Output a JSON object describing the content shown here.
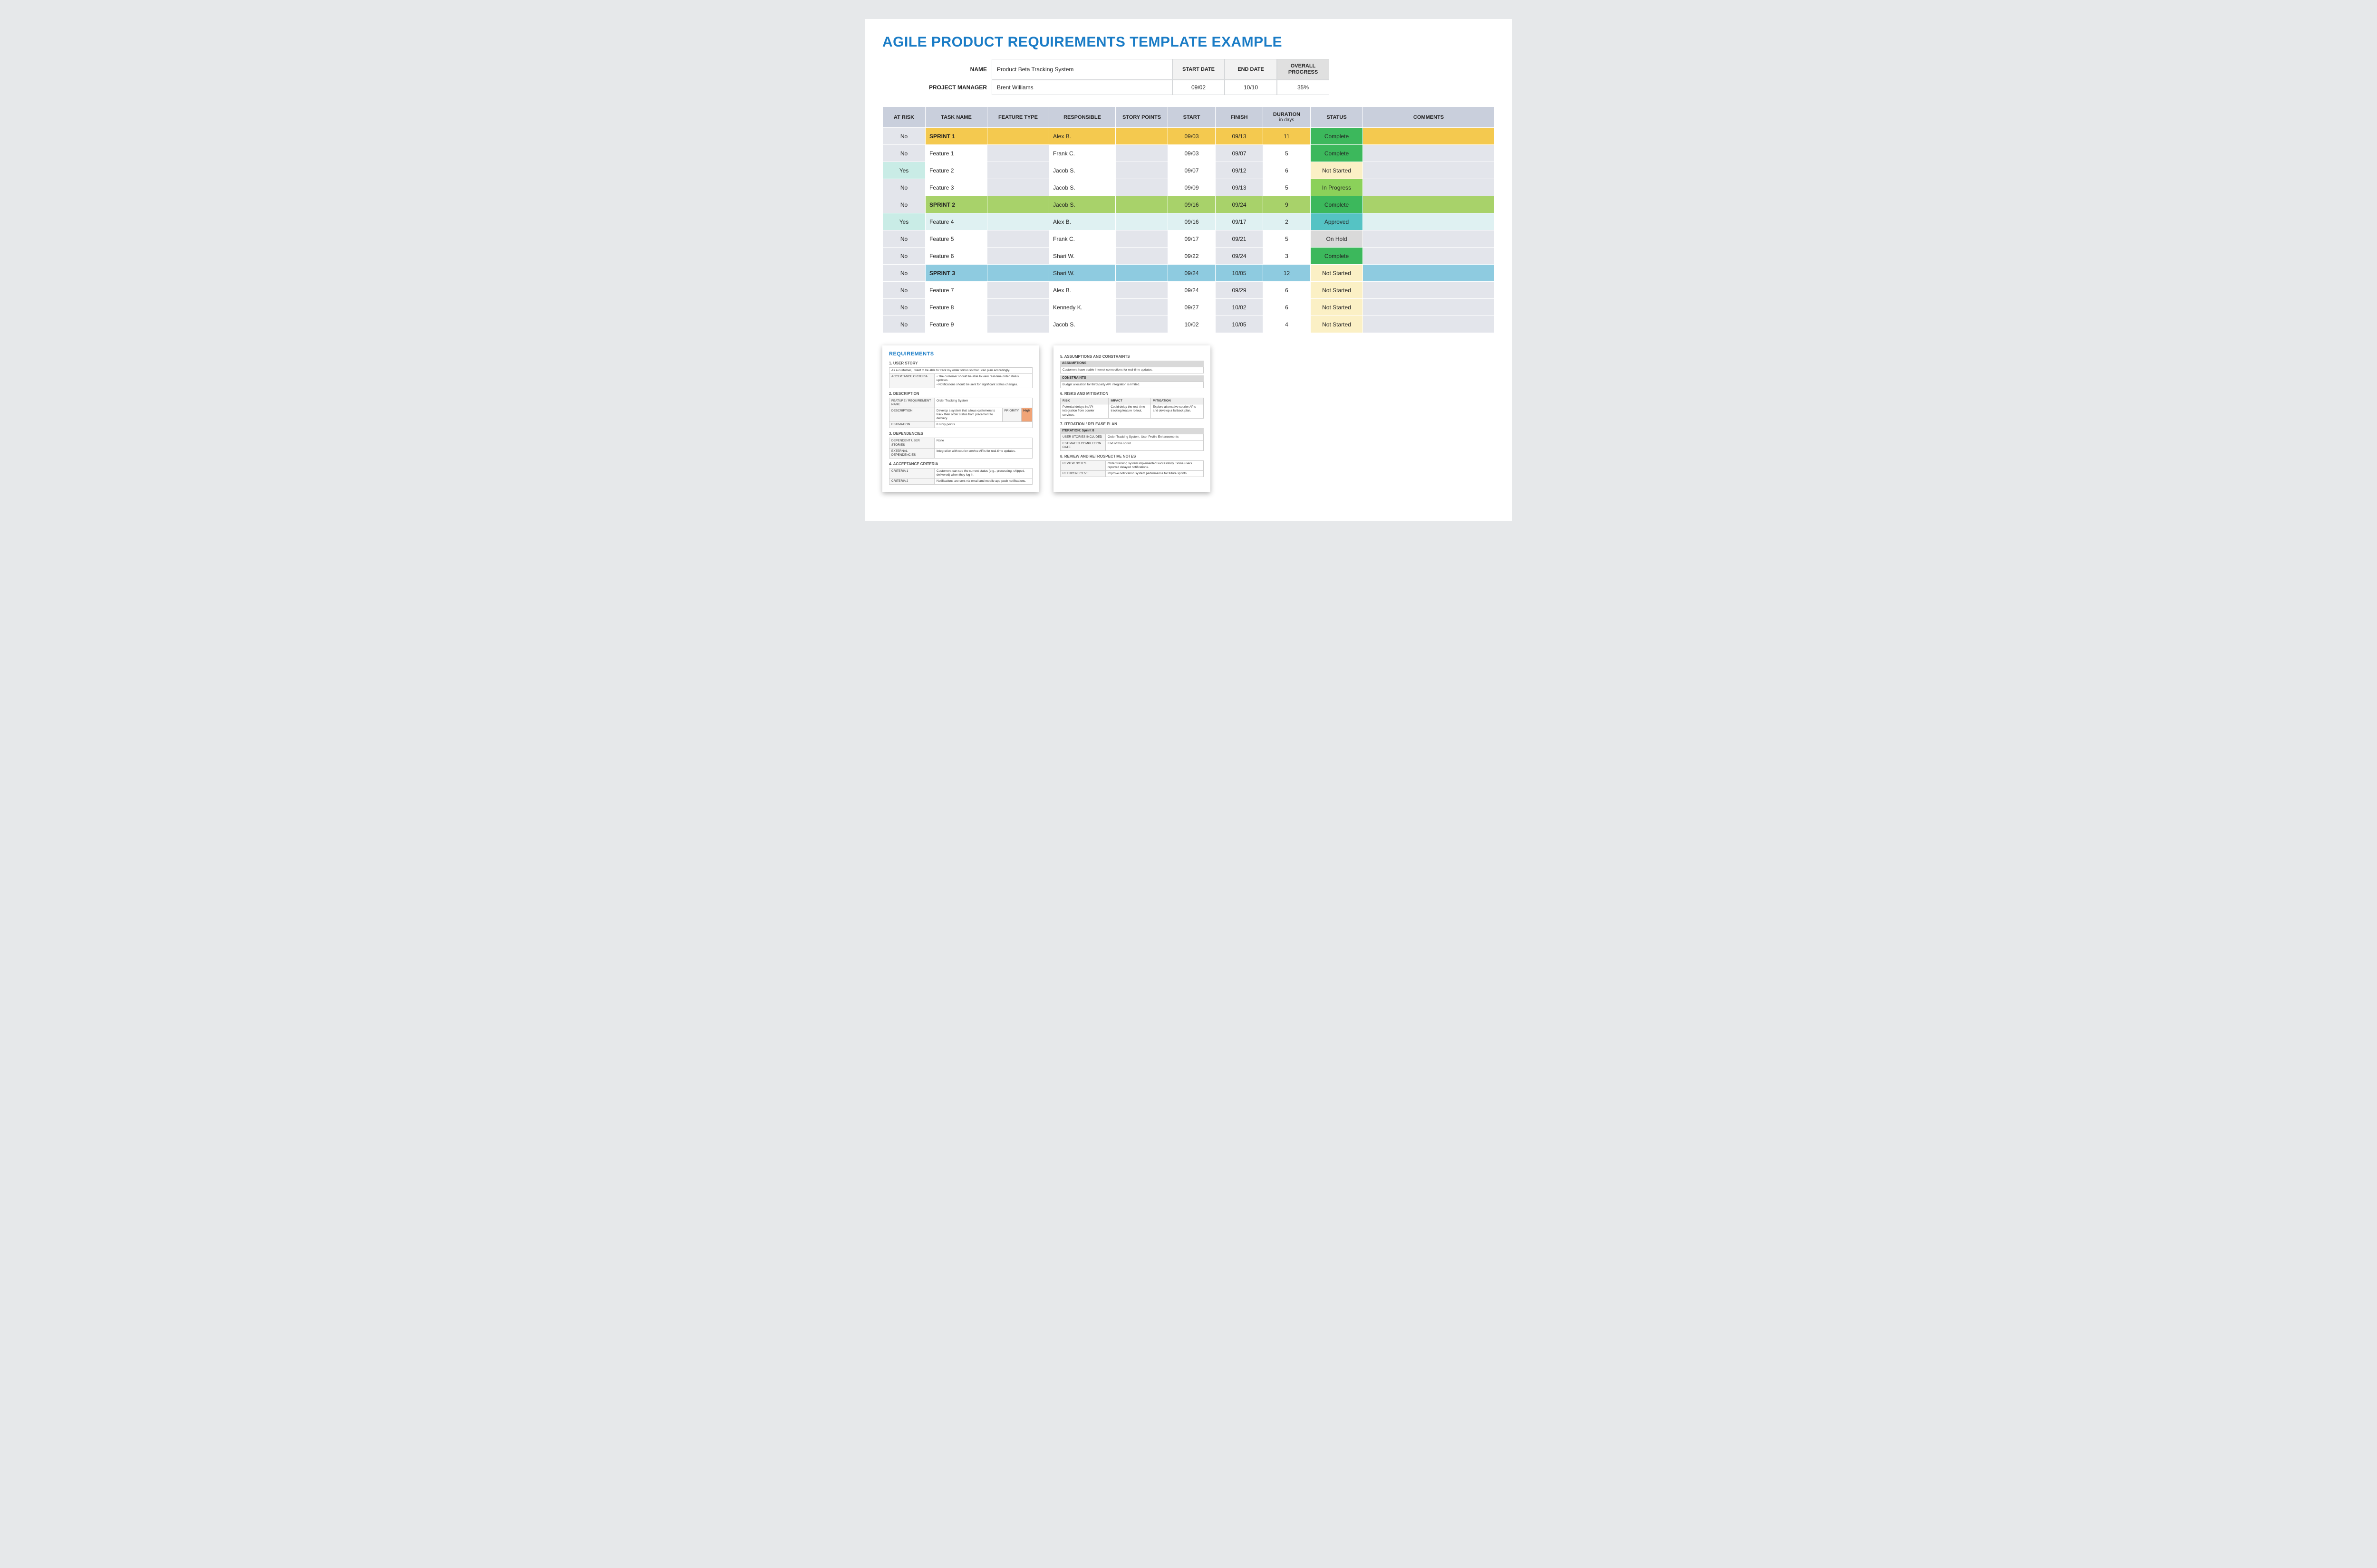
{
  "title": "AGILE PRODUCT REQUIREMENTS TEMPLATE EXAMPLE",
  "header": {
    "name_label": "NAME",
    "name_value": "Product Beta Tracking System",
    "pm_label": "PROJECT MANAGER",
    "pm_value": "Brent Williams",
    "start_label": "START DATE",
    "end_label": "END DATE",
    "progress_label": "OVERALL PROGRESS",
    "start_value": "09/02",
    "end_value": "10/10",
    "progress_value": "35%"
  },
  "columns": {
    "risk": "AT RISK",
    "task": "TASK NAME",
    "ftype": "FEATURE TYPE",
    "resp": "RESPONSIBLE",
    "story": "STORY POINTS",
    "start": "START",
    "finish": "FINISH",
    "dur": "DURATION",
    "dur_sub": "in days",
    "status": "STATUS",
    "comments": "COMMENTS"
  },
  "rows": [
    {
      "risk": "No",
      "task": "SPRINT 1",
      "resp": "Alex B.",
      "start": "09/03",
      "finish": "09/13",
      "dur": "11",
      "status": "Complete",
      "st": "st-complete",
      "tint": "tint-yellow"
    },
    {
      "risk": "No",
      "task": "Feature 1",
      "resp": "Frank C.",
      "start": "09/03",
      "finish": "09/07",
      "dur": "5",
      "status": "Complete",
      "st": "st-complete"
    },
    {
      "risk": "Yes",
      "task": "Feature 2",
      "resp": "Jacob S.",
      "start": "09/07",
      "finish": "09/12",
      "dur": "6",
      "status": "Not Started",
      "st": "st-notstarted"
    },
    {
      "risk": "No",
      "task": "Feature 3",
      "resp": "Jacob S.",
      "start": "09/09",
      "finish": "09/13",
      "dur": "5",
      "status": "In Progress",
      "st": "st-inprogress"
    },
    {
      "risk": "No",
      "task": "SPRINT 2",
      "resp": "Jacob S.",
      "start": "09/16",
      "finish": "09/24",
      "dur": "9",
      "status": "Complete",
      "st": "st-complete",
      "tint": "tint-green"
    },
    {
      "risk": "Yes",
      "task": "Feature 4",
      "resp": "Alex B.",
      "start": "09/16",
      "finish": "09/17",
      "dur": "2",
      "status": "Approved",
      "st": "st-approved",
      "tint": "feat-teal"
    },
    {
      "risk": "No",
      "task": "Feature 5",
      "resp": "Frank C.",
      "start": "09/17",
      "finish": "09/21",
      "dur": "5",
      "status": "On Hold",
      "st": "st-onhold"
    },
    {
      "risk": "No",
      "task": "Feature 6",
      "resp": "Shari W.",
      "start": "09/22",
      "finish": "09/24",
      "dur": "3",
      "status": "Complete",
      "st": "st-complete"
    },
    {
      "risk": "No",
      "task": "SPRINT 3",
      "resp": "Shari W.",
      "start": "09/24",
      "finish": "10/05",
      "dur": "12",
      "status": "Not Started",
      "st": "st-notstarted",
      "tint": "tint-blue"
    },
    {
      "risk": "No",
      "task": "Feature 7",
      "resp": "Alex B.",
      "start": "09/24",
      "finish": "09/29",
      "dur": "6",
      "status": "Not Started",
      "st": "st-notstarted"
    },
    {
      "risk": "No",
      "task": "Feature 8",
      "resp": "Kennedy K.",
      "start": "09/27",
      "finish": "10/02",
      "dur": "6",
      "status": "Not Started",
      "st": "st-notstarted"
    },
    {
      "risk": "No",
      "task": "Feature 9",
      "resp": "Jacob S.",
      "start": "10/02",
      "finish": "10/05",
      "dur": "4",
      "status": "Not Started",
      "st": "st-notstarted"
    }
  ],
  "thumb1": {
    "title": "REQUIREMENTS",
    "s1": "1. USER STORY",
    "story": "As a customer, I want to be able to track my order status so that I can plan accordingly.",
    "ac_label": "ACCEPTANCE CRITERIA",
    "ac_b1": "• The customer should be able to view real-time order status updates.",
    "ac_b2": "• Notifications should be sent for significant status changes.",
    "s2": "2. DESCRIPTION",
    "fr_label": "FEATURE / REQUIREMENT NAME",
    "fr_value": "Order Tracking System",
    "desc_label": "DESCRIPTION",
    "desc_value": "Develop a system that allows customers to track their order status from placement to delivery.",
    "prio_label": "PRIORITY",
    "prio_value": "High",
    "est_label": "ESTIMATION",
    "est_value": "8 story points",
    "s3": "3. DEPENDENCIES",
    "dep1_label": "DEPENDENT USER STORIES",
    "dep1_value": "None",
    "dep2_label": "EXTERNAL DEPENDENCIES",
    "dep2_value": "Integration with courier service APIs for real-time updates.",
    "s4": "4. ACCEPTANCE CRITERIA",
    "c1_label": "CRITERIA 1",
    "c1_value": "Customers can see the current status (e.g., processing, shipped, delivered) when they log in.",
    "c2_label": "CRITERIA 2",
    "c2_value": "Notifications are sent via email and mobile app push notifications."
  },
  "thumb2": {
    "s5": "5. ASSUMPTIONS AND CONSTRAINTS",
    "assump_h": "ASSUMPTIONS",
    "assump_v": "Customers have stable internet connections for real-time updates.",
    "constr_h": "CONSTRAINTS",
    "constr_v": "Budget allocation for third-party API integration is limited.",
    "s6": "6. RISKS AND MITIGATION",
    "rh1": "RISK",
    "rh2": "IMPACT",
    "rh3": "MITIGATION",
    "r1": "Potential delays in API integration from courier services.",
    "r2": "Could delay the real-time tracking feature rollout.",
    "r3": "Explore alternative courier APIs and develop a fallback plan.",
    "s7": "7. ITERATION / RELEASE PLAN",
    "it_h": "ITERATION: Sprint 8",
    "us_label": "USER STORIES INCLUDED",
    "us_value": "Order Tracking System, User Profile Enhancements",
    "ec_label": "ESTIMATED COMPLETION DATE",
    "ec_value": "End of this sprint",
    "s8": "8. REVIEW AND RETROSPECTIVE NOTES",
    "rn_label": "REVIEW NOTES",
    "rn_value": "Order tracking system implemented successfully. Some users reported delayed notifications.",
    "re_label": "RETROSPECTIVE",
    "re_value": "Improve notification system performance for future sprints."
  }
}
